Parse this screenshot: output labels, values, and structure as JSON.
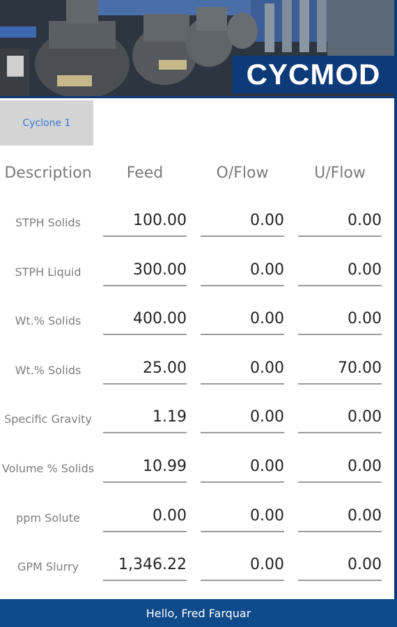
{
  "header": {
    "logo_text": "CYCMOD"
  },
  "tabs": [
    {
      "label": "Cyclone 1",
      "active": true
    }
  ],
  "table": {
    "columns": [
      "Description",
      "Feed",
      "O/Flow",
      "U/Flow"
    ],
    "rows": [
      {
        "label": "STPH Solids",
        "feed": "100.00",
        "oflow": "0.00",
        "uflow": "0.00"
      },
      {
        "label": "STPH Liquid",
        "feed": "300.00",
        "oflow": "0.00",
        "uflow": "0.00"
      },
      {
        "label": "Wt.% Solids",
        "feed": "400.00",
        "oflow": "0.00",
        "uflow": "0.00"
      },
      {
        "label": "Wt.% Solids",
        "feed": "25.00",
        "oflow": "0.00",
        "uflow": "70.00"
      },
      {
        "label": "Specific Gravity",
        "feed": "1.19",
        "oflow": "0.00",
        "uflow": "0.00"
      },
      {
        "label": "Volume % Solids",
        "feed": "10.99",
        "oflow": "0.00",
        "uflow": "0.00"
      },
      {
        "label": "ppm Solute",
        "feed": "0.00",
        "oflow": "0.00",
        "uflow": "0.00"
      },
      {
        "label": "GPM Slurry",
        "feed": "1,346.22",
        "oflow": "0.00",
        "uflow": "0.00"
      }
    ]
  },
  "footer": {
    "greeting": "Hello, Fred Farquar"
  },
  "colors": {
    "brand": "#0d3a78",
    "footer_bg": "#0f4a8a",
    "tab_text": "#3b78d4",
    "tab_bg": "#d4d4d4"
  }
}
